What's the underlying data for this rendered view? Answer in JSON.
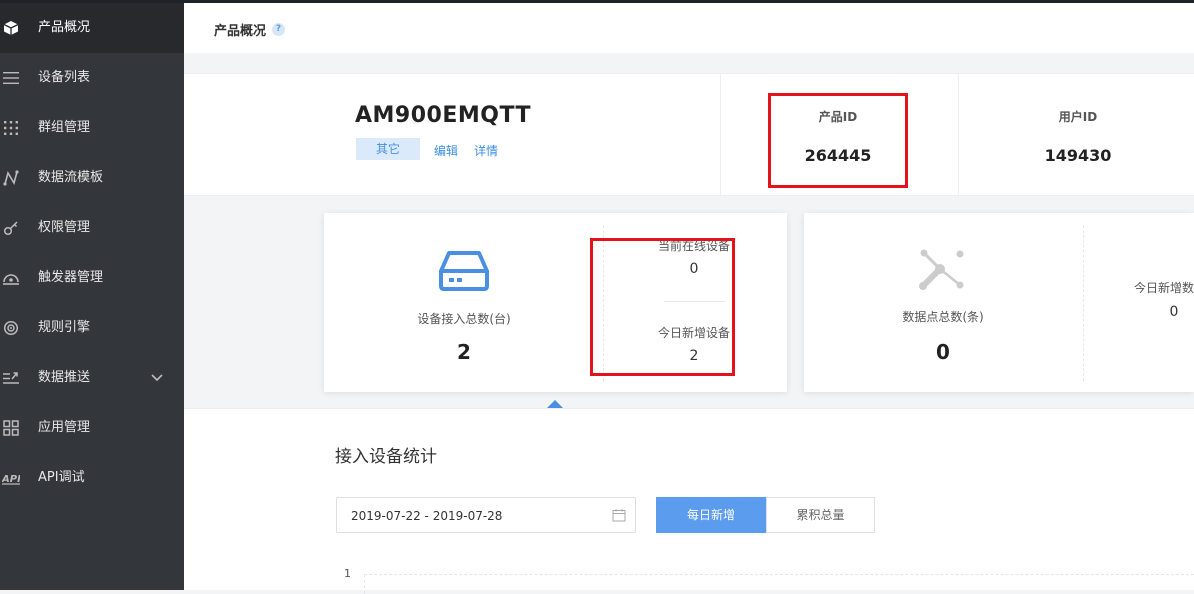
{
  "sidebar": {
    "items": [
      {
        "label": "产品概况",
        "icon": "cube-icon",
        "active": true
      },
      {
        "label": "设备列表",
        "icon": "list-icon"
      },
      {
        "label": "群组管理",
        "icon": "grid-dots-icon"
      },
      {
        "label": "数据流模板",
        "icon": "flow-icon"
      },
      {
        "label": "权限管理",
        "icon": "key-icon"
      },
      {
        "label": "触发器管理",
        "icon": "trigger-icon"
      },
      {
        "label": "规则引擎",
        "icon": "rule-icon"
      },
      {
        "label": "数据推送",
        "icon": "push-icon",
        "has_chevron": true
      },
      {
        "label": "应用管理",
        "icon": "apps-icon"
      },
      {
        "label": "API调试",
        "icon": "api-icon"
      }
    ]
  },
  "header": {
    "title": "产品概况",
    "help": "?"
  },
  "product": {
    "name": "AM900EMQTT",
    "tag": "其它",
    "edit_link": "编辑",
    "detail_link": "详情",
    "product_id_label": "产品ID",
    "product_id": "264445",
    "user_id_label": "用户ID",
    "user_id": "149430"
  },
  "devices_card": {
    "total_label": "设备接入总数(台)",
    "total_value": "2",
    "online_label": "当前在线设备",
    "online_value": "0",
    "new_today_label": "今日新增设备",
    "new_today_value": "2"
  },
  "datapoints_card": {
    "total_label": "数据点总数(条)",
    "total_value": "0",
    "new_today_label": "今日新增数",
    "new_today_value": "0"
  },
  "stats": {
    "title": "接入设备统计",
    "date_range": "2019-07-22 - 2019-07-28",
    "daily_button": "每日新增",
    "total_button": "累积总量"
  },
  "chart_data": {
    "type": "line",
    "y_tick_labels": [
      "1"
    ]
  },
  "colors": {
    "sidebar_bg": "#33363b",
    "accent": "#5b9cef",
    "highlight_box": "#e3131b"
  }
}
